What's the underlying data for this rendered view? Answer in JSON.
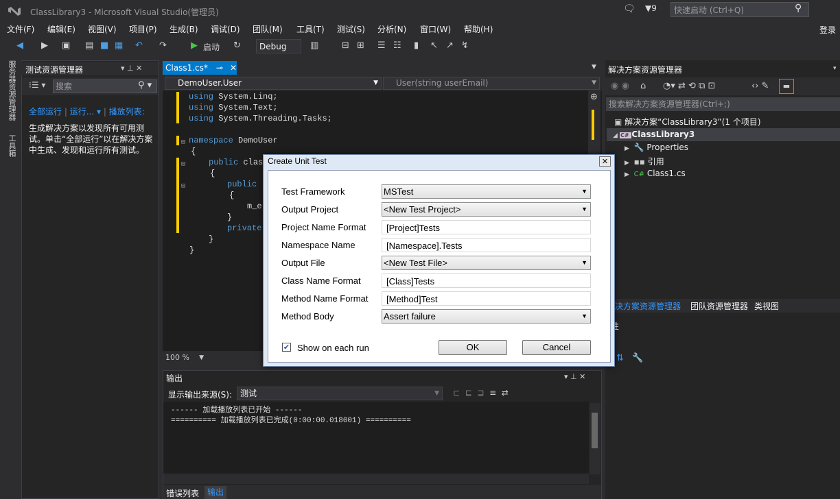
{
  "window": {
    "title": "ClassLibrary3 - Microsoft Visual Studio(管理员)",
    "filter_count": "9",
    "quick_launch_placeholder": "快速启动 (Ctrl+Q)",
    "login": "登录"
  },
  "menu": [
    "文件(F)",
    "编辑(E)",
    "视图(V)",
    "项目(P)",
    "生成(B)",
    "调试(D)",
    "团队(M)",
    "工具(T)",
    "测试(S)",
    "分析(N)",
    "窗口(W)",
    "帮助(H)"
  ],
  "toolbar": {
    "start_label": "启动",
    "config": "Debug"
  },
  "left_strip": {
    "tab1": "服务器资源管理器",
    "tab2": "工具箱"
  },
  "test_explorer": {
    "title": "测试资源管理器",
    "search_placeholder": "搜索",
    "run_all": "全部运行",
    "run": "运行...",
    "playlist": "播放列表:",
    "message": "生成解决方案以发现所有可用测试。单击“全部运行”以在解决方案中生成、发现和运行所有测试。"
  },
  "editor": {
    "tab": "Class1.cs*",
    "nav_left": "DemoUser.User",
    "nav_right": "User(string userEmail)",
    "zoom": "100 %",
    "lines": [
      {
        "kw": "using",
        "rest": " System.Linq;"
      },
      {
        "kw": "using",
        "rest": " System.Text;"
      },
      {
        "kw": "using",
        "rest": " System.Threading.Tasks;"
      },
      {
        "kw": "namespace",
        "rest": " DemoUser"
      },
      {
        "kw": "",
        "rest": "{"
      },
      {
        "kw": "public",
        "rest": " clas"
      },
      {
        "kw": "",
        "rest": "{"
      },
      {
        "kw": "public",
        "rest": " "
      },
      {
        "kw": "",
        "rest": "{"
      },
      {
        "kw": "",
        "rest": "m_e"
      },
      {
        "kw": "",
        "rest": "}"
      },
      {
        "kw": "private",
        "rest": ""
      },
      {
        "kw": "",
        "rest": "}"
      },
      {
        "kw": "",
        "rest": "}"
      }
    ]
  },
  "output": {
    "title": "输出",
    "source_label": "显示输出来源(S):",
    "source_value": "测试",
    "lines": [
      "------ 加载播放列表已开始 ------",
      "========== 加载播放列表已完成(0:00:00.018001) =========="
    ],
    "tab_errors": "错误列表",
    "tab_output": "输出"
  },
  "solution_explorer": {
    "title": "解决方案资源管理器",
    "search_placeholder": "搜索解决方案资源管理器(Ctrl+;)",
    "solution": "解决方案“ClassLibrary3”(1 个项目)",
    "project": "ClassLibrary3",
    "items": [
      "Properties",
      "引用",
      "Class1.cs"
    ],
    "tabs": [
      "决方案资源管理器",
      "团队资源管理器",
      "类视图"
    ],
    "properties_title": "性"
  },
  "dialog": {
    "title": "Create Unit Test",
    "fields": [
      {
        "label": "Test Framework",
        "value": "MSTest",
        "kind": "combo"
      },
      {
        "label": "Output Project",
        "value": "<New Test Project>",
        "kind": "combo"
      },
      {
        "label": "Project Name Format",
        "value": "[Project]Tests",
        "kind": "text"
      },
      {
        "label": "Namespace Name",
        "value": "[Namespace].Tests",
        "kind": "text"
      },
      {
        "label": "Output File",
        "value": "<New Test File>",
        "kind": "combo"
      },
      {
        "label": "Class Name Format",
        "value": "[Class]Tests",
        "kind": "text"
      },
      {
        "label": "Method Name Format",
        "value": "[Method]Test",
        "kind": "text"
      },
      {
        "label": "Method Body",
        "value": "Assert failure",
        "kind": "combo"
      }
    ],
    "show_each_run": "Show on each run",
    "ok": "OK",
    "cancel": "Cancel"
  },
  "colors": {
    "accent": "#007acc",
    "bg": "#2d2d30",
    "editor": "#1e1e1e",
    "link": "#3399ff"
  }
}
